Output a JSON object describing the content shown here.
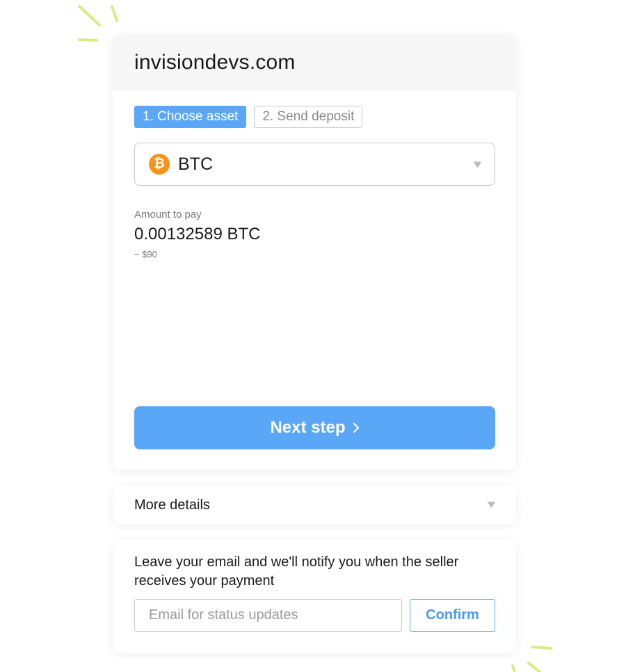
{
  "header": {
    "site_title": "invisiondevs.com"
  },
  "steps": [
    {
      "label": "1. Choose asset",
      "active": true
    },
    {
      "label": "2. Send deposit",
      "active": false
    }
  ],
  "asset_select": {
    "selected": "BTC",
    "icon": "bitcoin-icon",
    "icon_glyph": "₿"
  },
  "amount": {
    "label": "Amount to pay",
    "value": "0.00132589 BTC",
    "fiat": "~ $90"
  },
  "next_button": {
    "label": "Next step"
  },
  "details": {
    "label": "More details"
  },
  "email_section": {
    "message": "Leave your email and we'll notify you when the seller receives your payment",
    "placeholder": "Email for status updates",
    "value": "",
    "confirm_label": "Confirm"
  },
  "colors": {
    "accent": "#5aa6f7",
    "bitcoin": "#f7931a",
    "decoration": "#d4ef7f"
  }
}
